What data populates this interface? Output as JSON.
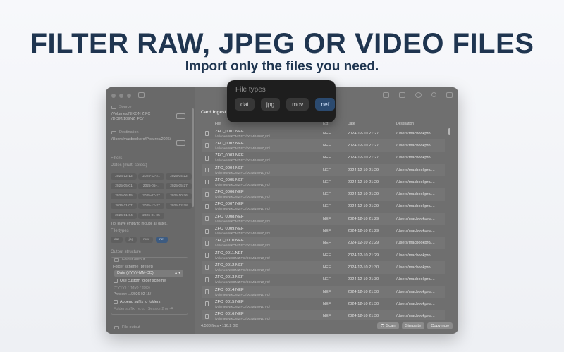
{
  "hero": {
    "title": "FILTER RAW, JPEG OR VIDEO FILES",
    "subtitle": "Import only the files you need."
  },
  "sidebar": {
    "source_label": "Source",
    "source_path": "/Volumes/NIKON Z FC /DCIM/109NZ_FC/",
    "destination_label": "Destination",
    "destination_path": "/Users/macbookpro/Pictures/2026/",
    "filters_label": "Filters",
    "dates_label": "Dates (multi-select)",
    "dates": [
      "2024-12-12",
      "2024-12-21",
      "2025-04-22",
      "2025-05-01",
      "2025-05-...",
      "2025-05-27",
      "2025-06-15",
      "2025-07-27",
      "2025-10-26",
      "2025-11-07",
      "2025-12-27",
      "2025-12-28",
      "2026-01-04",
      "2026-01-05"
    ],
    "tip": "Tip: leave empty to include all dates.",
    "file_types_label": "File types",
    "file_types": [
      "dat",
      "jpg",
      "mov",
      "nef"
    ],
    "file_type_selected": "nef",
    "output_structure_label": "Output structure",
    "folder_output_label": "Folder output",
    "folder_scheme_label": "Folder scheme (preset)",
    "folder_scheme_value": "Date (YYYY-MM-DD)",
    "custom_scheme_label": "Use custom folder scheme",
    "custom_scheme_placeholder": "{YYYY} / {MM} / {DD}",
    "preview": "Preview: .../2026-02-15/",
    "append_suffix_label": "Append suffix to folders",
    "folder_suffix_label": "Folder suffix",
    "folder_suffix_placeholder": "e.g. _Session2 or -A",
    "file_output_label": "File output"
  },
  "main": {
    "card_title": "Card Ingest",
    "columns": {
      "file": "File",
      "ext": "Ext",
      "date": "Date",
      "destination": "Destination"
    },
    "rows": [
      {
        "name": "ZFC_0001.NEF",
        "path": "/Volumes/NIKON Z FC /DCIM/109NZ_FC/",
        "ext": "NEF",
        "date": "2024-12-10 21:27",
        "dest": "/Users/macbookpro/..."
      },
      {
        "name": "ZFC_0002.NEF",
        "path": "/Volumes/NIKON Z FC /DCIM/109NZ_FC/",
        "ext": "NEF",
        "date": "2024-12-10 21:27",
        "dest": "/Users/macbookpro/..."
      },
      {
        "name": "ZFC_0003.NEF",
        "path": "/Volumes/NIKON Z FC /DCIM/109NZ_FC/",
        "ext": "NEF",
        "date": "2024-12-10 21:27",
        "dest": "/Users/macbookpro/..."
      },
      {
        "name": "ZFC_0004.NEF",
        "path": "/Volumes/NIKON Z FC /DCIM/109NZ_FC/",
        "ext": "NEF",
        "date": "2024-12-10 21:29",
        "dest": "/Users/macbookpro/..."
      },
      {
        "name": "ZFC_0005.NEF",
        "path": "/Volumes/NIKON Z FC /DCIM/109NZ_FC/",
        "ext": "NEF",
        "date": "2024-12-10 21:29",
        "dest": "/Users/macbookpro/..."
      },
      {
        "name": "ZFC_0006.NEF",
        "path": "/Volumes/NIKON Z FC /DCIM/109NZ_FC/",
        "ext": "NEF",
        "date": "2024-12-10 21:29",
        "dest": "/Users/macbookpro/..."
      },
      {
        "name": "ZFC_0007.NEF",
        "path": "/Volumes/NIKON Z FC /DCIM/109NZ_FC/",
        "ext": "NEF",
        "date": "2024-12-10 21:29",
        "dest": "/Users/macbookpro/..."
      },
      {
        "name": "ZFC_0008.NEF",
        "path": "/Volumes/NIKON Z FC /DCIM/109NZ_FC/",
        "ext": "NEF",
        "date": "2024-12-10 21:29",
        "dest": "/Users/macbookpro/..."
      },
      {
        "name": "ZFC_0009.NEF",
        "path": "/Volumes/NIKON Z FC /DCIM/109NZ_FC/",
        "ext": "NEF",
        "date": "2024-12-10 21:29",
        "dest": "/Users/macbookpro/..."
      },
      {
        "name": "ZFC_0010.NEF",
        "path": "/Volumes/NIKON Z FC /DCIM/109NZ_FC/",
        "ext": "NEF",
        "date": "2024-12-10 21:29",
        "dest": "/Users/macbookpro/..."
      },
      {
        "name": "ZFC_0011.NEF",
        "path": "/Volumes/NIKON Z FC /DCIM/109NZ_FC/",
        "ext": "NEF",
        "date": "2024-12-10 21:29",
        "dest": "/Users/macbookpro/..."
      },
      {
        "name": "ZFC_0012.NEF",
        "path": "/Volumes/NIKON Z FC /DCIM/109NZ_FC/",
        "ext": "NEF",
        "date": "2024-12-10 21:30",
        "dest": "/Users/macbookpro/..."
      },
      {
        "name": "ZFC_0013.NEF",
        "path": "/Volumes/NIKON Z FC /DCIM/109NZ_FC/",
        "ext": "NEF",
        "date": "2024-12-10 21:30",
        "dest": "/Users/macbookpro/..."
      },
      {
        "name": "ZFC_0014.NEF",
        "path": "/Volumes/NIKON Z FC /DCIM/109NZ_FC/",
        "ext": "NEF",
        "date": "2024-12-10 21:30",
        "dest": "/Users/macbookpro/..."
      },
      {
        "name": "ZFC_0015.NEF",
        "path": "/Volumes/NIKON Z FC /DCIM/109NZ_FC/",
        "ext": "NEF",
        "date": "2024-12-10 21:30",
        "dest": "/Users/macbookpro/..."
      },
      {
        "name": "ZFC_0016.NEF",
        "path": "/Volumes/NIKON Z FC /DCIM/109NZ_FC/",
        "ext": "NEF",
        "date": "2024-12-10 21:30",
        "dest": "/Users/macbookpro/..."
      }
    ],
    "status": "4.588 files • 116.2 GB",
    "buttons": {
      "scan": "Scan",
      "simulate": "Simulate",
      "copy": "Copy now"
    }
  },
  "popover": {
    "title": "File types",
    "chips": [
      "dat",
      "jpg",
      "mov",
      "nef"
    ],
    "selected": "nef"
  },
  "toolbar": {
    "icons": [
      "folder-icon",
      "drive-icon",
      "circle-icon",
      "search-icon",
      "sidebar-right-icon"
    ]
  },
  "colors": {
    "headline": "#1f3550",
    "selected_chip": "#2b4a6f",
    "window_bg": "#6f6f6f",
    "popover_bg": "#1e1e1e"
  }
}
